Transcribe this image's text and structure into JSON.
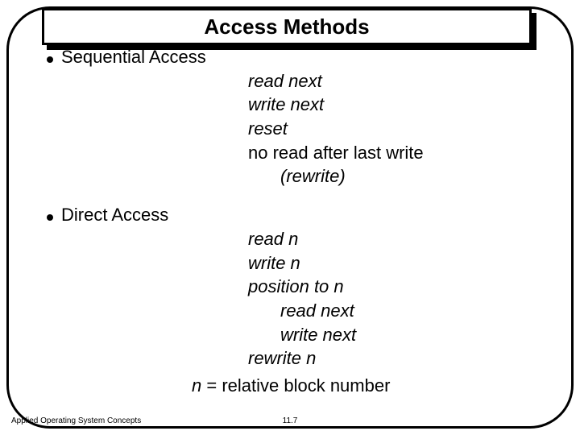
{
  "title": "Access Methods",
  "bullets": {
    "seq": {
      "label": "Sequential Access",
      "ops": {
        "read_next": "read next",
        "write_next": "write next",
        "reset": "reset",
        "no_read": "no read after last write",
        "rewrite": "(rewrite)"
      }
    },
    "direct": {
      "label": "Direct Access",
      "ops": {
        "read_n": "read n",
        "write_n": "write n",
        "position_to_n": "position to n",
        "read_next": "read next",
        "write_next": "write next",
        "rewrite_n": "rewrite n"
      },
      "note_n": "n",
      "note_eq": " = relative block number"
    }
  },
  "footer": "Applied Operating System Concepts",
  "page": "11.7"
}
